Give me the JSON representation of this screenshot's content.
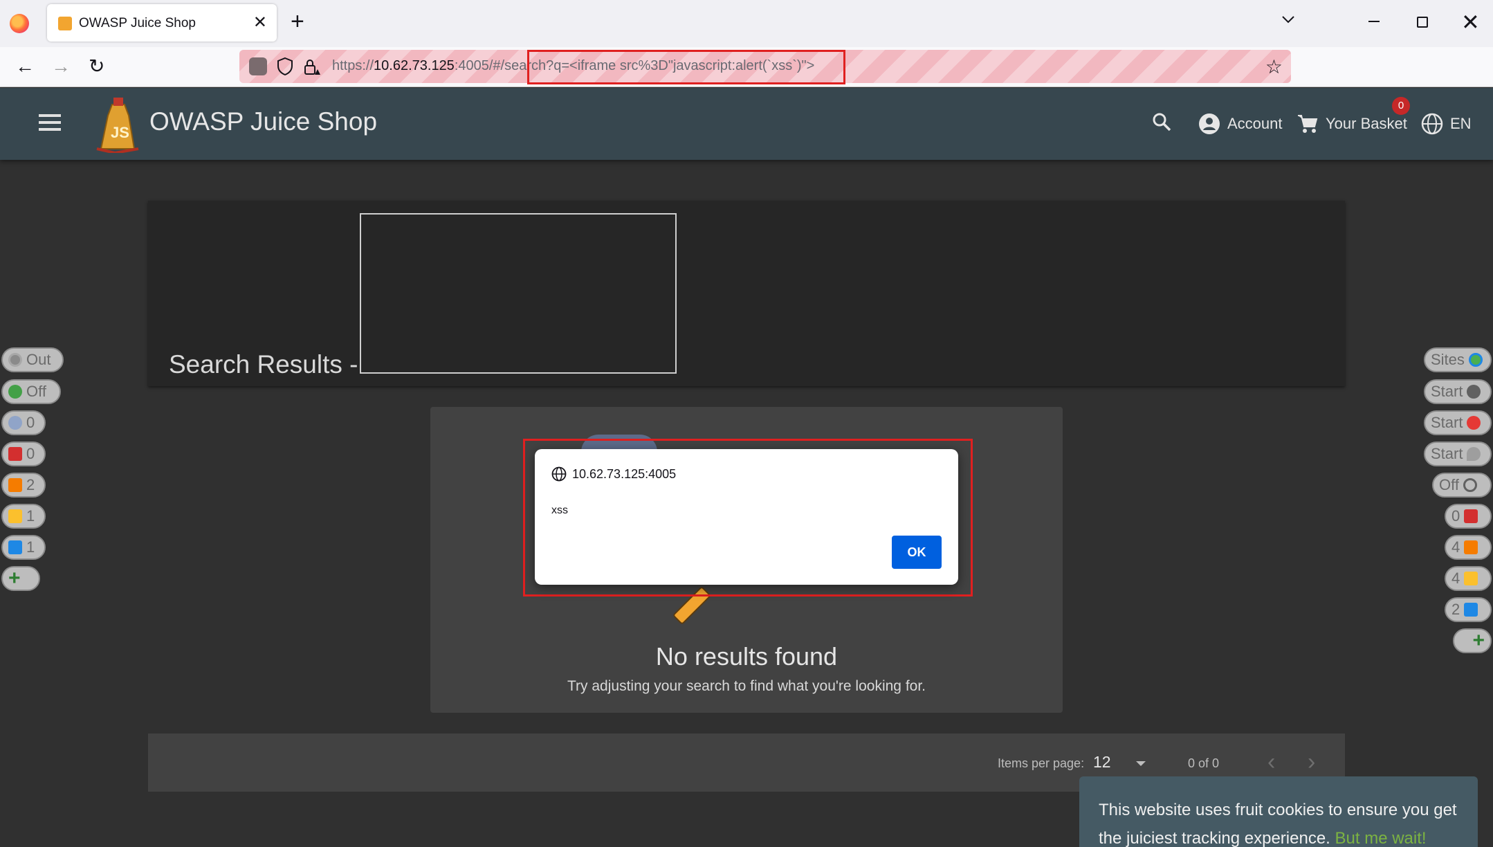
{
  "browser": {
    "tab_title": "OWASP Juice Shop",
    "url_prefix": "https://",
    "url_host": "10.62.73.125",
    "url_rest": ":4005/#/search?q=<iframe src%3D\"javascript:alert(`xss`)\">"
  },
  "app": {
    "title": "OWASP Juice Shop",
    "account_label": "Account",
    "basket_label": "Your Basket",
    "basket_count": "0",
    "language": "EN"
  },
  "search": {
    "results_title": "Search Results -",
    "no_results_title": "No results found",
    "no_results_hint": "Try adjusting your search to find what you're looking for."
  },
  "paginator": {
    "items_per_page_label": "Items per page:",
    "items_per_page_value": "12",
    "range_label": "0 of 0"
  },
  "left_tabs": [
    {
      "label": "Out",
      "icon": "target-icon"
    },
    {
      "label": "Off",
      "icon": "green-dot-icon"
    },
    {
      "label": "0",
      "icon": "lightbulb-icon"
    },
    {
      "label": "0",
      "icon": "red-flag-icon"
    },
    {
      "label": "2",
      "icon": "orange-flag-icon"
    },
    {
      "label": "1",
      "icon": "yellow-flag-icon"
    },
    {
      "label": "1",
      "icon": "blue-flag-icon"
    }
  ],
  "right_tabs": [
    {
      "label": "Sites",
      "icon": "globe-icon"
    },
    {
      "label": "Start",
      "icon": "spider-icon"
    },
    {
      "label": "Start",
      "icon": "red-spider-icon"
    },
    {
      "label": "Start",
      "icon": "flame-icon"
    },
    {
      "label": "Off",
      "icon": "crosshair-icon"
    },
    {
      "label": "0",
      "icon": "red-flag-icon"
    },
    {
      "label": "4",
      "icon": "orange-flag-icon"
    },
    {
      "label": "4",
      "icon": "yellow-flag-icon"
    },
    {
      "label": "2",
      "icon": "blue-flag-icon"
    }
  ],
  "alert": {
    "origin": "10.62.73.125:4005",
    "message": "xss",
    "ok_label": "OK"
  },
  "cookie": {
    "text": "This website uses fruit cookies to ensure you get the juiciest tracking experience.",
    "link": "But me wait!"
  },
  "colors": {
    "toolbar": "#37474f",
    "highlight": "#e02020",
    "ok_button": "#0060df"
  }
}
